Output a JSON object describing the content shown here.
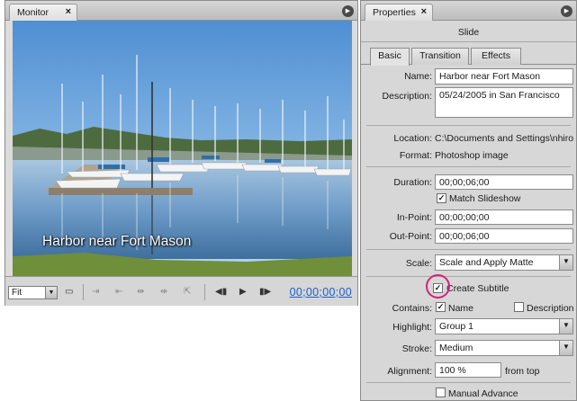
{
  "monitor": {
    "tab_label": "Monitor",
    "overlay_title": "Harbor near Fort Mason",
    "toolbar": {
      "fit_value": "Fit",
      "timecode": "00;00;00;00"
    }
  },
  "properties": {
    "tab_label": "Properties",
    "subtitle": "Slide",
    "tabs": [
      "Basic",
      "Transition",
      "Effects"
    ],
    "name_label": "Name:",
    "name_value": "Harbor near Fort Mason",
    "description_label": "Description:",
    "description_value": "05/24/2005 in San Francisco",
    "location_label": "Location:",
    "location_value": "C:\\Documents and Settings\\nhiro",
    "format_label": "Format:",
    "format_value": "Photoshop image",
    "duration_label": "Duration:",
    "duration_value": "00;00;06;00",
    "match_slideshow_label": "Match Slideshow",
    "in_point_label": "In-Point:",
    "in_point_value": "00;00;00;00",
    "out_point_label": "Out-Point:",
    "out_point_value": "00;00;06;00",
    "scale_label": "Scale:",
    "scale_value": "Scale and Apply Matte",
    "create_subtitle_label": "Create Subtitle",
    "contains_label": "Contains:",
    "contains_name_label": "Name",
    "contains_description_label": "Description",
    "highlight_label": "Highlight:",
    "highlight_value": "Group 1",
    "stroke_label": "Stroke:",
    "stroke_value": "Medium",
    "alignment_label": "Alignment:",
    "alignment_value": "100 %",
    "alignment_suffix": "from top",
    "manual_advance_label": "Manual Advance"
  }
}
